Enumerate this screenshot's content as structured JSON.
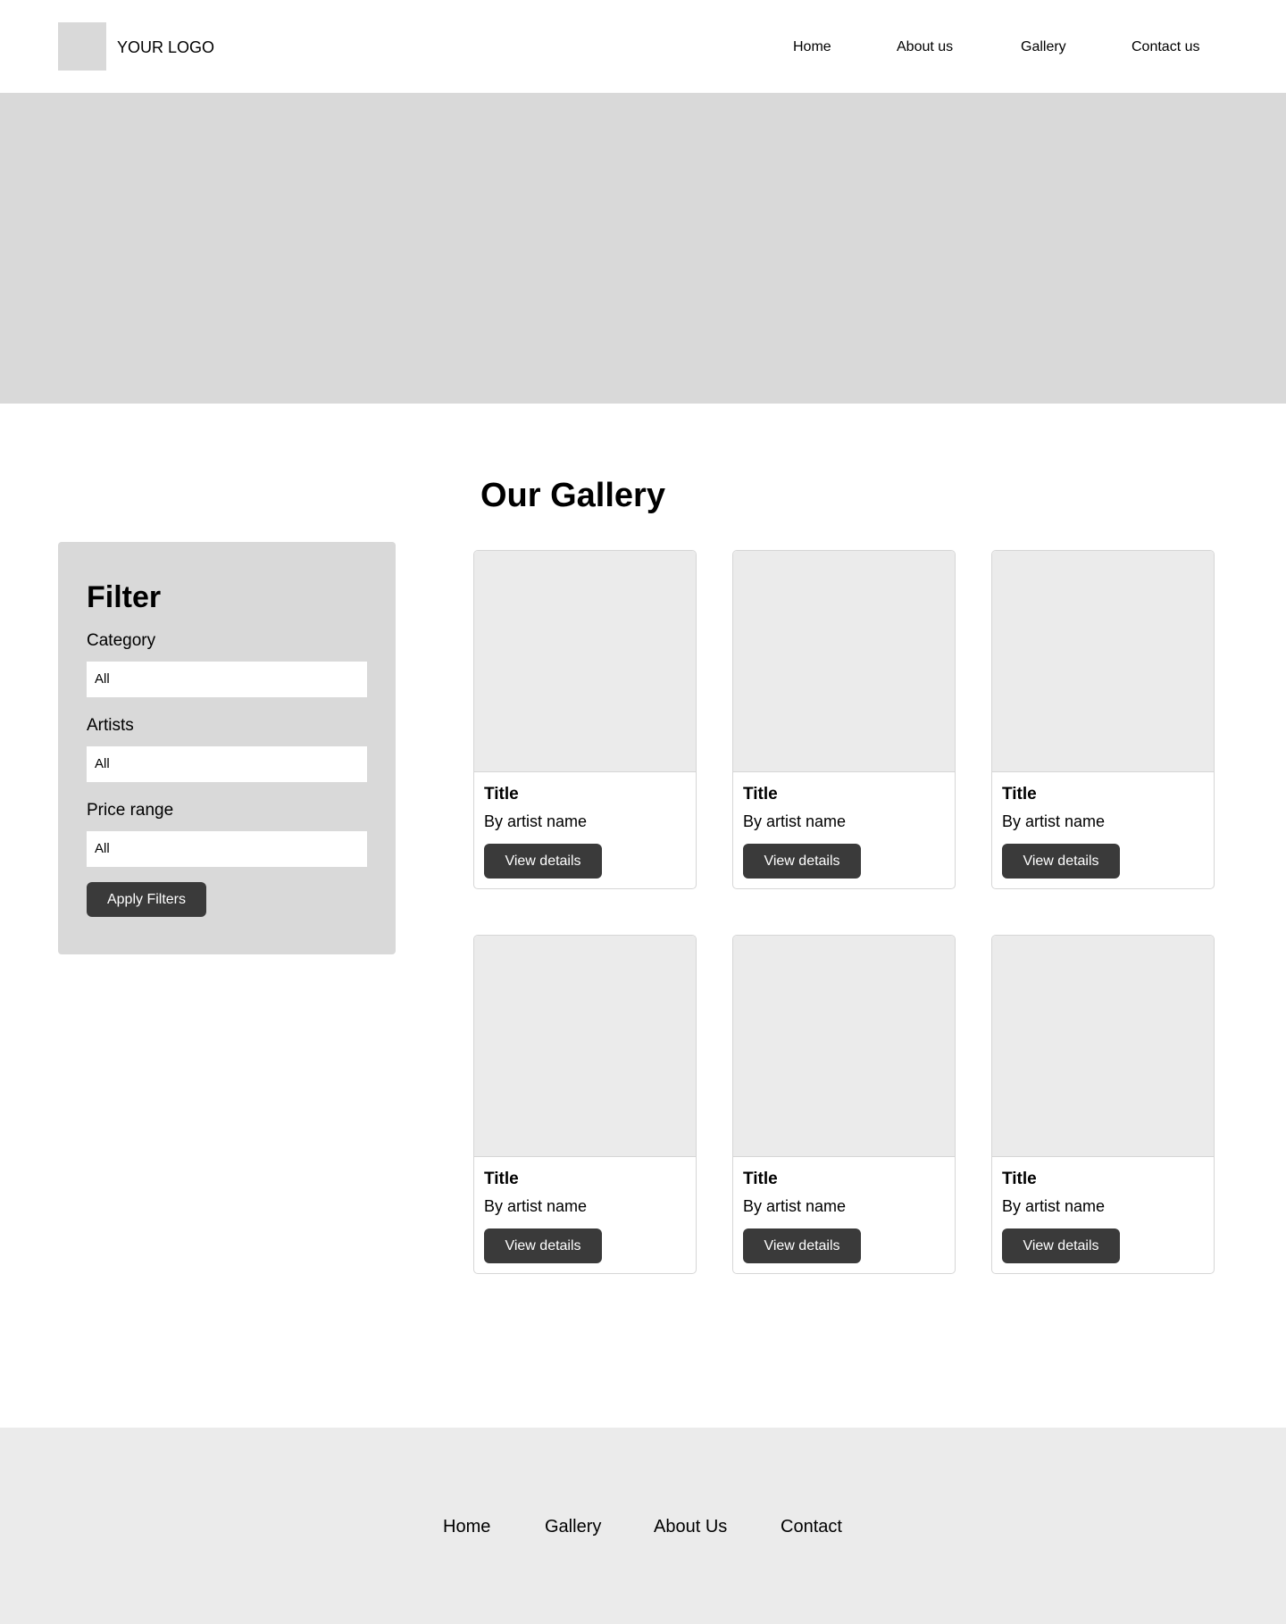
{
  "header": {
    "logo_text": "YOUR LOGO",
    "nav": [
      {
        "label": "Home"
      },
      {
        "label": "About us"
      },
      {
        "label": "Gallery"
      },
      {
        "label": "Contact us"
      }
    ]
  },
  "gallery": {
    "title": "Our Gallery",
    "cards": [
      {
        "title": "Title",
        "artist": "By artist name",
        "button": "View details"
      },
      {
        "title": "Title",
        "artist": "By artist name",
        "button": "View details"
      },
      {
        "title": "Title",
        "artist": "By artist name",
        "button": "View details"
      },
      {
        "title": "Title",
        "artist": "By artist name",
        "button": "View details"
      },
      {
        "title": "Title",
        "artist": "By artist name",
        "button": "View details"
      },
      {
        "title": "Title",
        "artist": "By artist name",
        "button": "View details"
      }
    ]
  },
  "filter": {
    "title": "Filter",
    "category": {
      "label": "Category",
      "value": "All"
    },
    "artists": {
      "label": "Artists",
      "value": "All"
    },
    "price": {
      "label": "Price range",
      "value": "All"
    },
    "apply_label": "Apply Filters"
  },
  "footer": {
    "links": [
      {
        "label": "Home"
      },
      {
        "label": "Gallery"
      },
      {
        "label": "About Us"
      },
      {
        "label": "Contact"
      }
    ]
  },
  "colors": {
    "placeholder_gray": "#d9d9d9",
    "card_image_gray": "#ebebeb",
    "button_dark": "#3a3a3a",
    "footer_bg": "#ebebeb"
  }
}
